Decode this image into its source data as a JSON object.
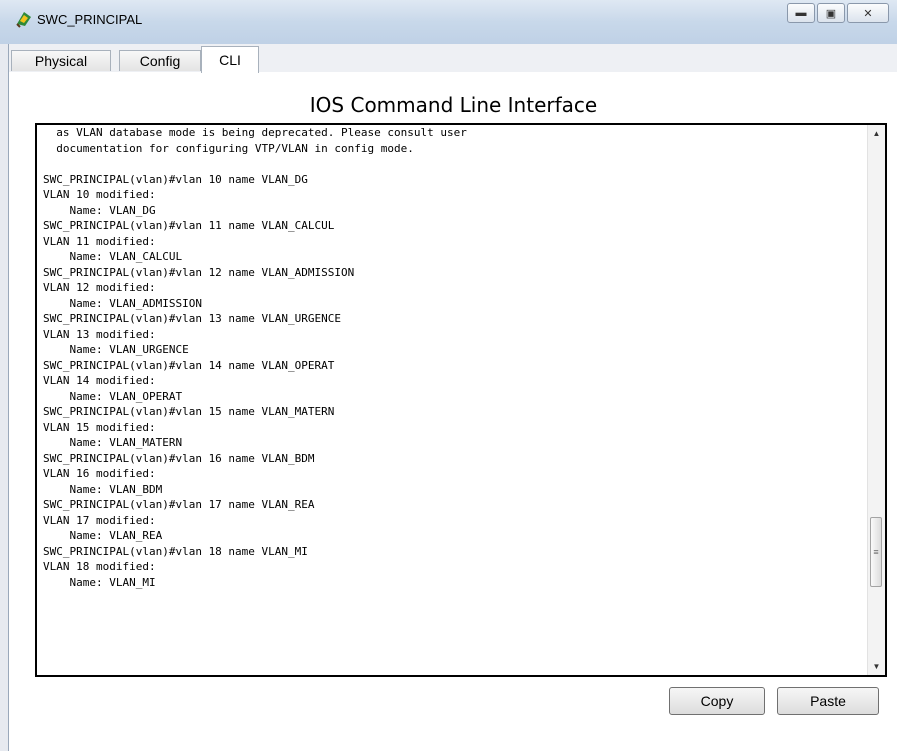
{
  "window": {
    "title": "SWC_PRINCIPAL",
    "icon": "packet-tracer-device-icon"
  },
  "window_controls": {
    "minimize": "minimize-icon",
    "maximize": "maximize-icon",
    "close": "close-icon"
  },
  "tabs": [
    {
      "label": "Physical"
    },
    {
      "label": "Config"
    },
    {
      "label": "CLI",
      "active": true
    }
  ],
  "cli": {
    "heading": "IOS Command Line Interface",
    "lines": [
      "  as VLAN database mode is being deprecated. Please consult user",
      "  documentation for configuring VTP/VLAN in config mode.",
      "",
      "SWC_PRINCIPAL(vlan)#vlan 10 name VLAN_DG",
      "VLAN 10 modified:",
      "    Name: VLAN_DG",
      "SWC_PRINCIPAL(vlan)#vlan 11 name VLAN_CALCUL",
      "VLAN 11 modified:",
      "    Name: VLAN_CALCUL",
      "SWC_PRINCIPAL(vlan)#vlan 12 name VLAN_ADMISSION",
      "VLAN 12 modified:",
      "    Name: VLAN_ADMISSION",
      "SWC_PRINCIPAL(vlan)#vlan 13 name VLAN_URGENCE",
      "VLAN 13 modified:",
      "    Name: VLAN_URGENCE",
      "SWC_PRINCIPAL(vlan)#vlan 14 name VLAN_OPERAT",
      "VLAN 14 modified:",
      "    Name: VLAN_OPERAT",
      "SWC_PRINCIPAL(vlan)#vlan 15 name VLAN_MATERN",
      "VLAN 15 modified:",
      "    Name: VLAN_MATERN",
      "SWC_PRINCIPAL(vlan)#vlan 16 name VLAN_BDM",
      "VLAN 16 modified:",
      "    Name: VLAN_BDM",
      "SWC_PRINCIPAL(vlan)#vlan 17 name VLAN_REA",
      "VLAN 17 modified:",
      "    Name: VLAN_REA",
      "SWC_PRINCIPAL(vlan)#vlan 18 name VLAN_MI",
      "VLAN 18 modified:",
      "    Name: VLAN_MI"
    ]
  },
  "buttons": {
    "copy": "Copy",
    "paste": "Paste"
  }
}
